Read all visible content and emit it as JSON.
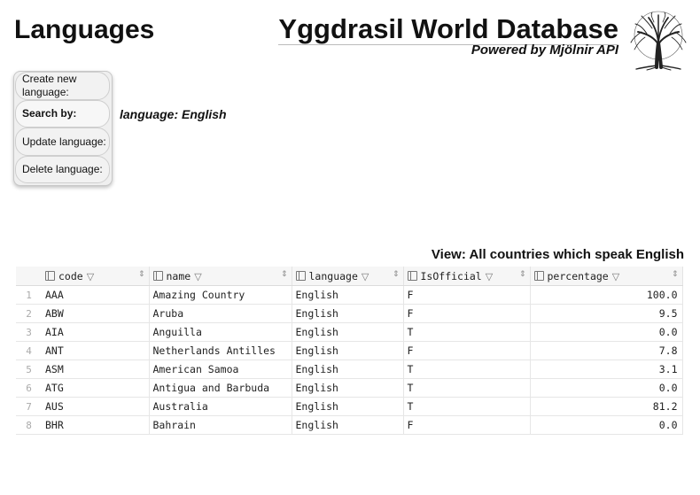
{
  "page": {
    "title": "Languages"
  },
  "brand": {
    "name": "Yggdrasil World Database",
    "subtitle": "Powered by Mjölnir API",
    "logo": "tree-logo"
  },
  "menu": {
    "items": [
      {
        "label": "Create new language:"
      },
      {
        "label": "Search by:",
        "selected": true
      },
      {
        "label": "Update language:"
      },
      {
        "label": "Delete language:"
      }
    ]
  },
  "current_filter": "language: English",
  "view_caption": "View: All countries which speak English",
  "table": {
    "columns": [
      "code",
      "name",
      "language",
      "IsOfficial",
      "percentage"
    ],
    "column_icon": "column-icon",
    "filter_icon": "filter-icon",
    "sort_icon": "sort-icon",
    "rows": [
      {
        "n": "1",
        "code": "AAA",
        "name": "Amazing Country",
        "language": "English",
        "official": "F",
        "percentage": "100.0"
      },
      {
        "n": "2",
        "code": "ABW",
        "name": "Aruba",
        "language": "English",
        "official": "F",
        "percentage": "9.5"
      },
      {
        "n": "3",
        "code": "AIA",
        "name": "Anguilla",
        "language": "English",
        "official": "T",
        "percentage": "0.0"
      },
      {
        "n": "4",
        "code": "ANT",
        "name": "Netherlands Antilles",
        "language": "English",
        "official": "F",
        "percentage": "7.8"
      },
      {
        "n": "5",
        "code": "ASM",
        "name": "American Samoa",
        "language": "English",
        "official": "T",
        "percentage": "3.1"
      },
      {
        "n": "6",
        "code": "ATG",
        "name": "Antigua and Barbuda",
        "language": "English",
        "official": "T",
        "percentage": "0.0"
      },
      {
        "n": "7",
        "code": "AUS",
        "name": "Australia",
        "language": "English",
        "official": "T",
        "percentage": "81.2"
      },
      {
        "n": "8",
        "code": "BHR",
        "name": "Bahrain",
        "language": "English",
        "official": "F",
        "percentage": "0.0"
      }
    ]
  }
}
